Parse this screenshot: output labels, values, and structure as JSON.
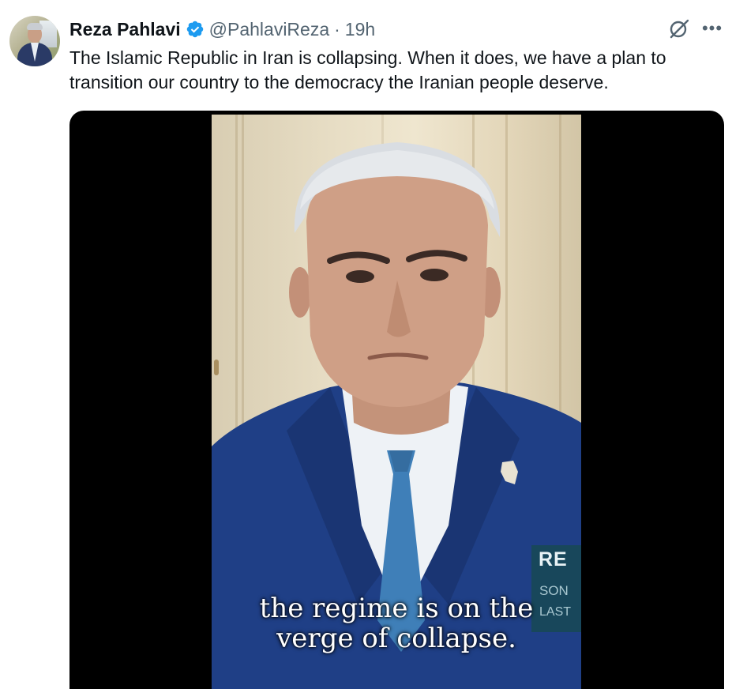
{
  "author": {
    "name": "Reza Pahlavi",
    "handle": "@PahlaviReza",
    "separator": "·",
    "time": "19h",
    "verified": true
  },
  "tweet": {
    "text": "The Islamic Republic in Iran is collapsing. When it does, we have a plan to transition our country to the democracy the Iranian people deserve."
  },
  "media": {
    "caption_line1": "the regime is on the",
    "caption_line2": "verge of collapse.",
    "lower_third_line1": "RE",
    "lower_third_line2": "SON",
    "lower_third_line3": "LAST"
  },
  "icons": {
    "verified": "verified-badge-icon",
    "grok": "grok-icon",
    "more": "more-icon"
  },
  "colors": {
    "text_primary": "#0f1419",
    "text_secondary": "#536471",
    "verified_blue": "#1d9bf0",
    "media_background": "#000000"
  }
}
